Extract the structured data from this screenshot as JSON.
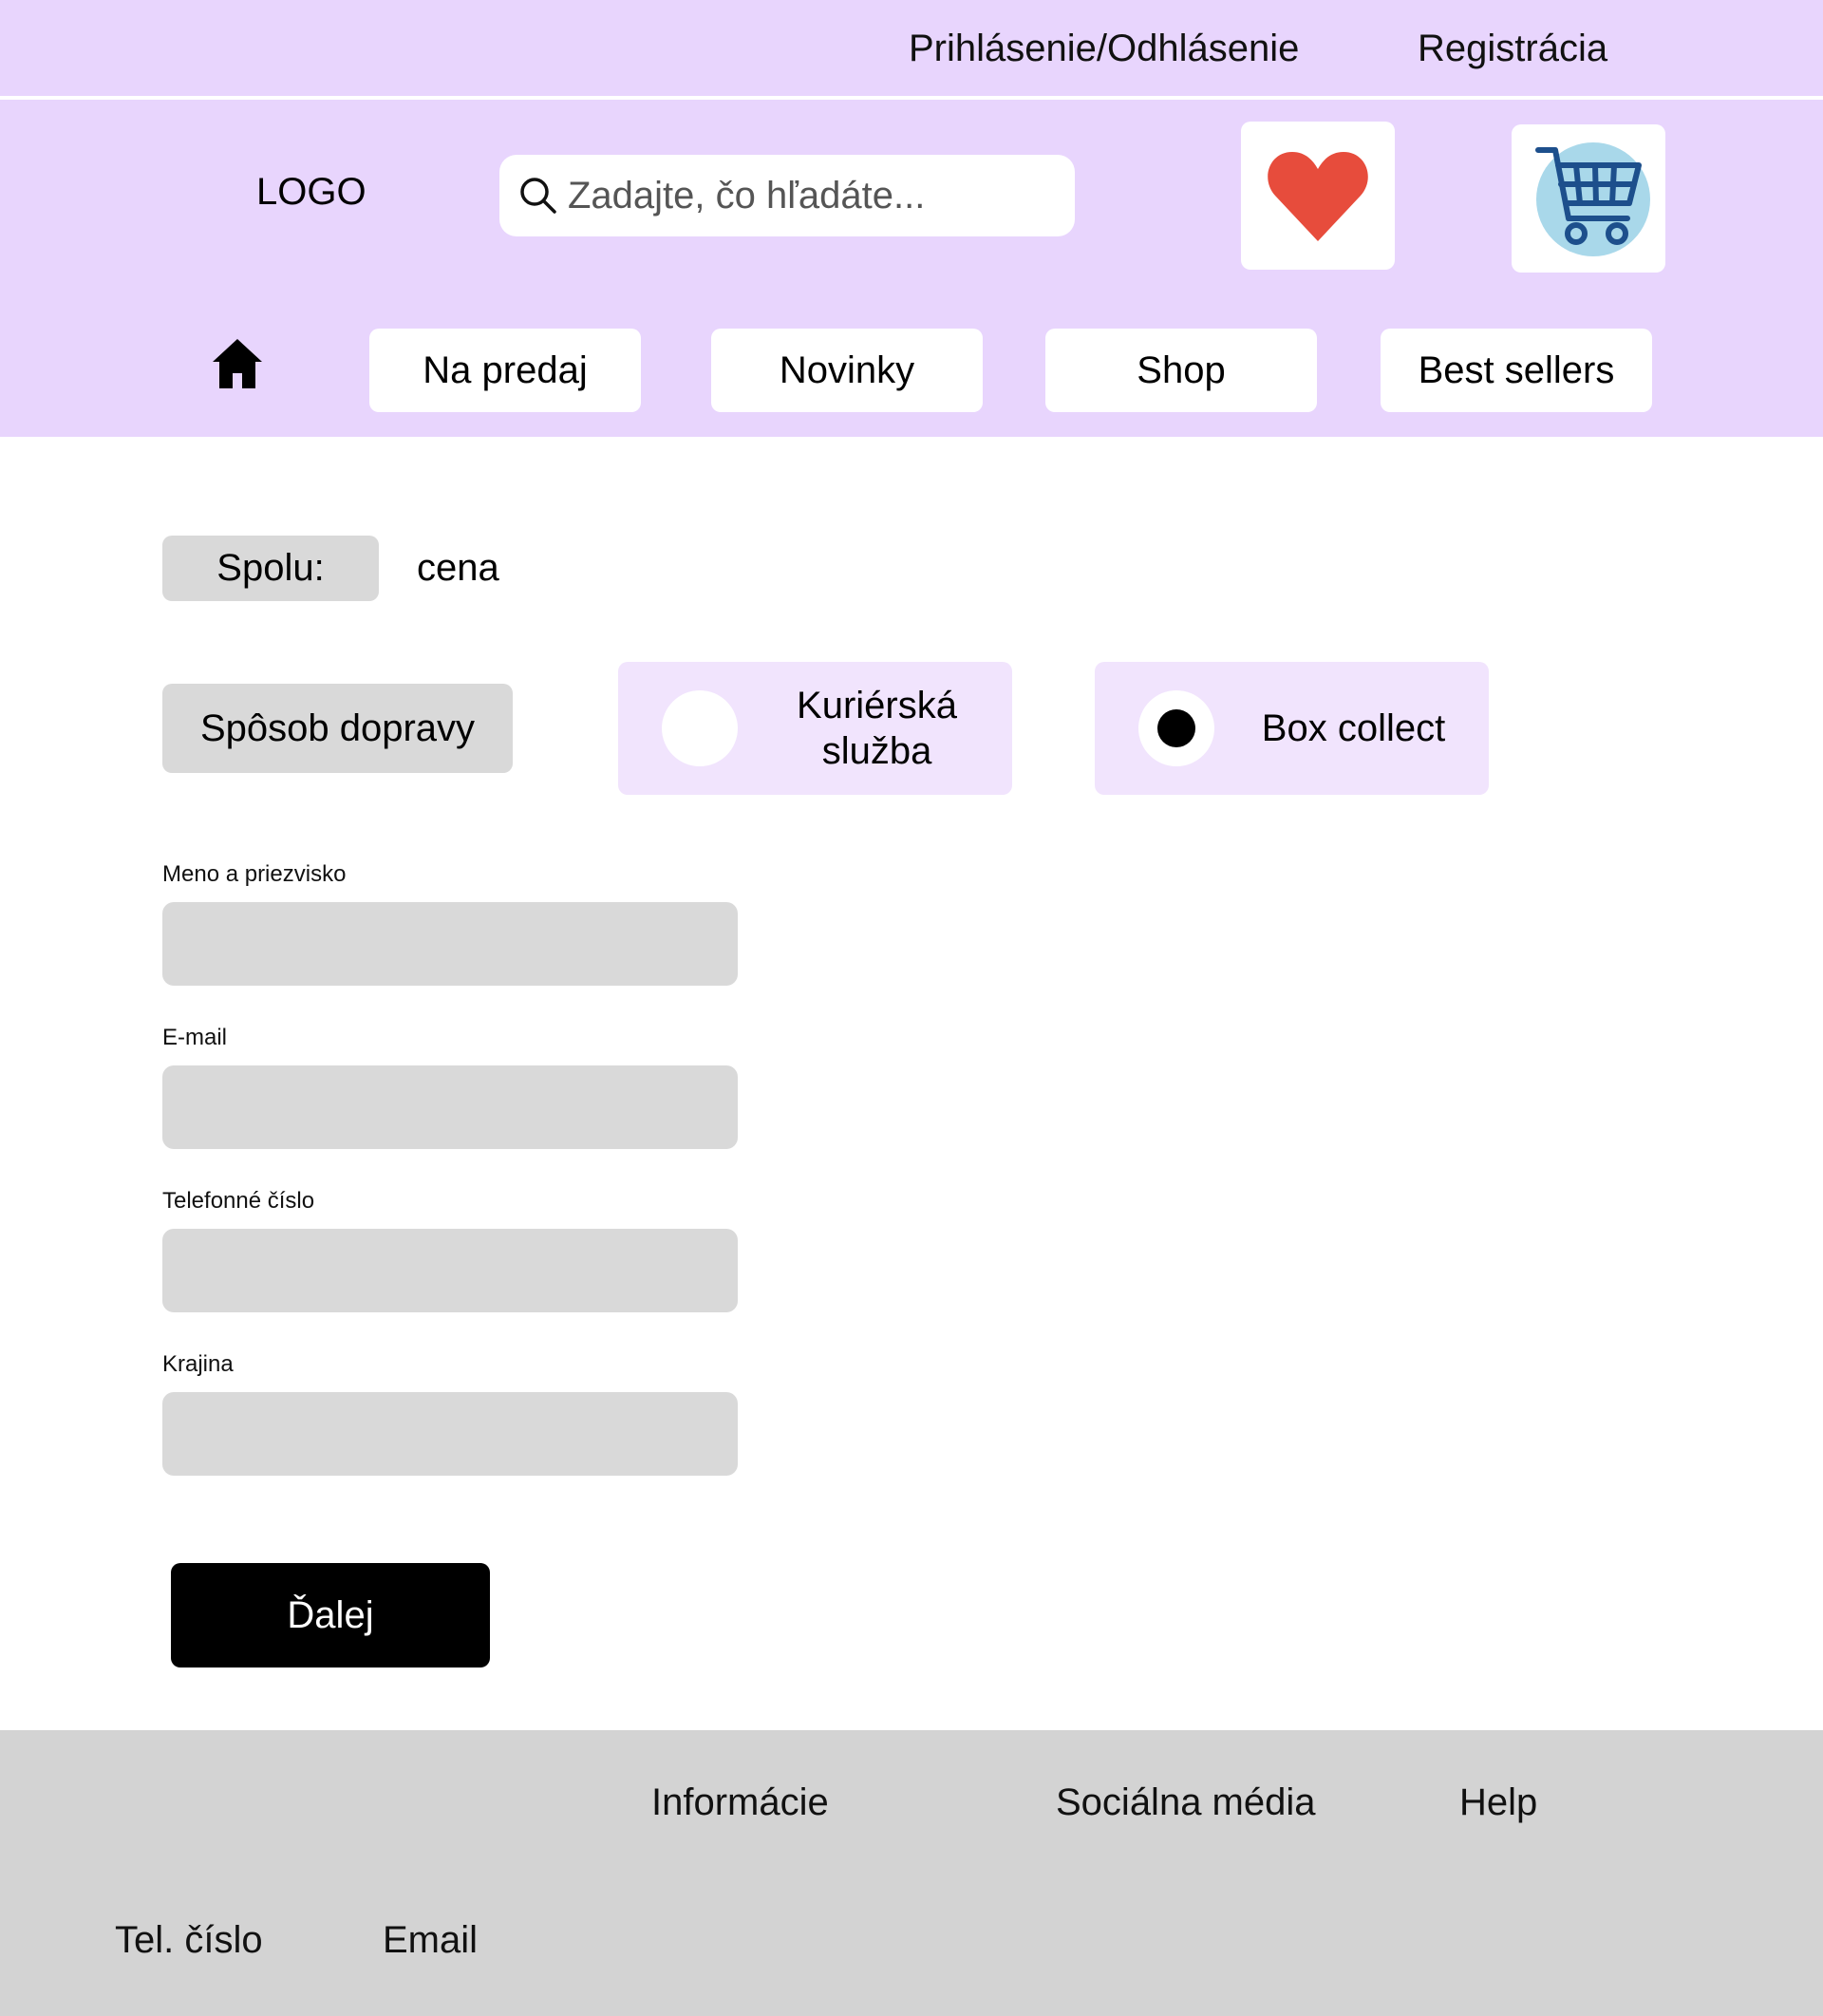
{
  "top_links": {
    "login": "Prihlásenie/Odhlásenie",
    "register": "Registrácia"
  },
  "header": {
    "logo": "LOGO",
    "search_placeholder": "Zadajte, čo hľadáte..."
  },
  "nav": {
    "items": [
      "Na predaj",
      "Novinky",
      "Shop",
      "Best sellers"
    ]
  },
  "summary": {
    "total_label": "Spolu:",
    "total_value": "cena"
  },
  "shipping": {
    "label": "Spôsob dopravy",
    "options": [
      {
        "label": "Kuriérská služba",
        "selected": false
      },
      {
        "label": "Box collect",
        "selected": true
      }
    ]
  },
  "form": {
    "fields": [
      {
        "label": "Meno a priezvisko",
        "value": ""
      },
      {
        "label": "E-mail",
        "value": ""
      },
      {
        "label": "Telefonné číslo",
        "value": ""
      },
      {
        "label": "Krajina",
        "value": ""
      }
    ],
    "next_label": "Ďalej"
  },
  "footer": {
    "info": "Informácie",
    "social": "Sociálna média",
    "help": "Help",
    "phone": "Tel. číslo",
    "email": "Email"
  },
  "colors": {
    "header_bg": "#e8d5fd",
    "radio_card_bg": "#f1e4fd",
    "input_bg": "#d9d9d9",
    "footer_bg": "#d3d3d3",
    "heart": "#e74c3c",
    "cart_circle": "#a9d8ea",
    "cart_stroke": "#1d4f8c"
  }
}
